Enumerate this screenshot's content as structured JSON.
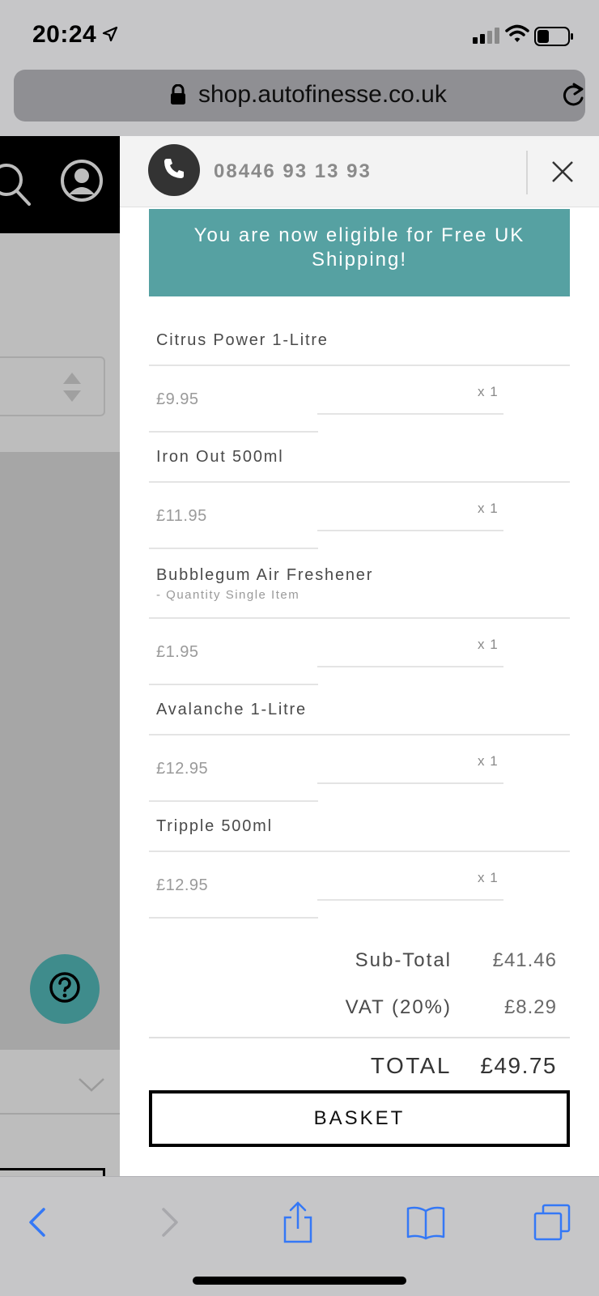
{
  "status_bar": {
    "time": "20:24",
    "icons": [
      "location-arrow-icon",
      "signal-icon",
      "wifi-icon",
      "battery-icon"
    ]
  },
  "browser": {
    "url": "shop.autofinesse.co.uk",
    "icons": [
      "lock-icon",
      "reload-icon"
    ]
  },
  "cart": {
    "phone_number": "08446 93 13 93",
    "banner_text": "You are now eligible for Free UK Shipping!",
    "items": [
      {
        "name": "Citrus Power 1-Litre",
        "variant": "",
        "price": "£9.95",
        "quantity": "x 1"
      },
      {
        "name": "Iron Out 500ml",
        "variant": "",
        "price": "£11.95",
        "quantity": "x 1"
      },
      {
        "name": "Bubblegum Air Freshener",
        "variant": "- Quantity Single Item",
        "price": "£1.95",
        "quantity": "x 1"
      },
      {
        "name": "Avalanche 1-Litre",
        "variant": "",
        "price": "£12.95",
        "quantity": "x 1"
      },
      {
        "name": "Tripple 500ml",
        "variant": "",
        "price": "£12.95",
        "quantity": "x 1"
      }
    ],
    "subtotal_label": "Sub-Total",
    "subtotal_value": "£41.46",
    "vat_label": "VAT (20%)",
    "vat_value": "£8.29",
    "total_label": "TOTAL",
    "total_value": "£49.75",
    "basket_button": "BASKET"
  },
  "colors": {
    "banner_bg": "#56a1a2",
    "help_button_bg": "#3f8c8c",
    "ios_blue": "#3478f6"
  }
}
